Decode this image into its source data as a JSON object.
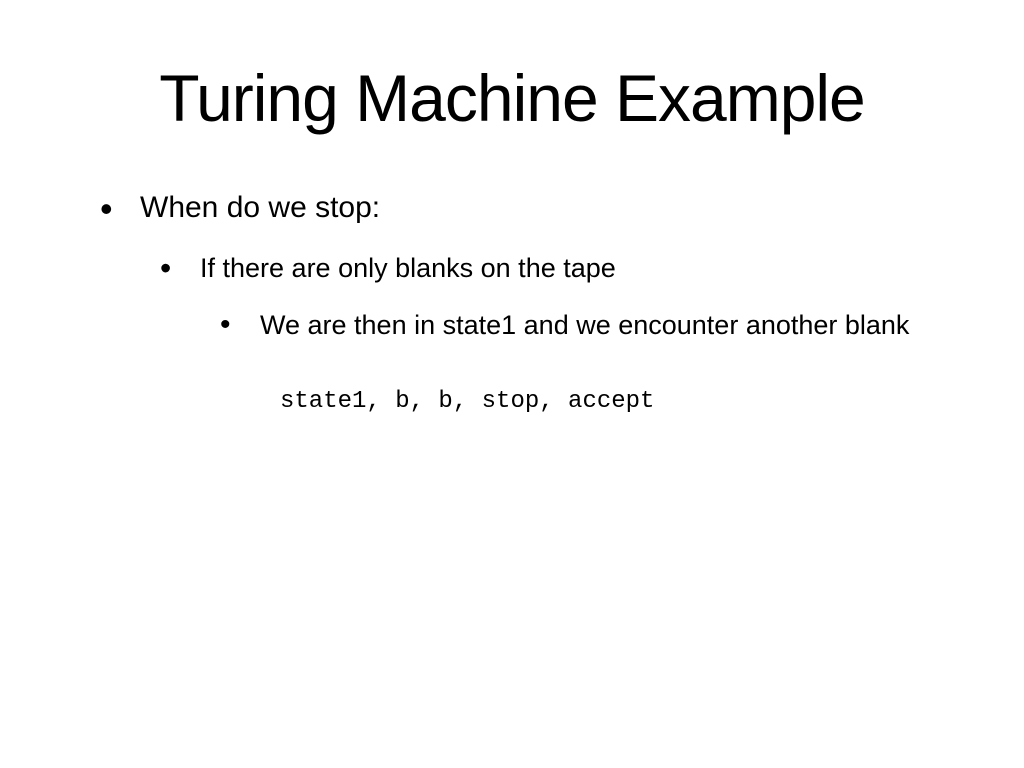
{
  "slide": {
    "title": "Turing Machine Example",
    "bullet1": "When do we stop:",
    "bullet2": "If there are only blanks on the tape",
    "bullet3": "We are then in state1 and we encounter another blank",
    "code": "state1, b, b, stop, accept"
  }
}
